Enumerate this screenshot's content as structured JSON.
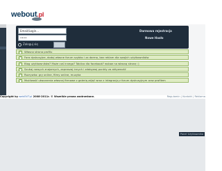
{
  "header": {
    "logo_text": "webout",
    "logo_tld": ".pl"
  },
  "login": {
    "login_placeholder": "Email/Login...",
    "password_value": "••••",
    "remember_label": "Zaloguj się",
    "register_link": "Darmowa rejestracja",
    "forgot_link": "Nowe Hasło"
  },
  "features": [
    "Własna strona profilu",
    "Fora dyskusyjne, dodaj własne forum szybko i za darmo, bez reklam dla swojich użytkowników",
    "Blog użytkowników? Może coś innego? Tablica dla facebook? wstaw na własną stronę :)",
    "Szukaj nowych znajomych, zapraszaj innych i zdobywaj punkty za aktywność",
    "Rozrywka: gry online, filmy online, muzyka",
    "Możliwość utworzenia własnej firmowe z galerią zdjęć wraz z integracją z forum dyskusyjnym oraz profilem"
  ],
  "footer": {
    "copyright_prefix": "Copyright by ",
    "copyright_link": "webOUT.pl",
    "copyright_suffix": " 2008-2011r. © Wszelkie prawa zastrzeżone.",
    "links": [
      "Regulamin",
      "Kontakt",
      "Reklama"
    ]
  },
  "panel_button": "Panel Użytkownika"
}
